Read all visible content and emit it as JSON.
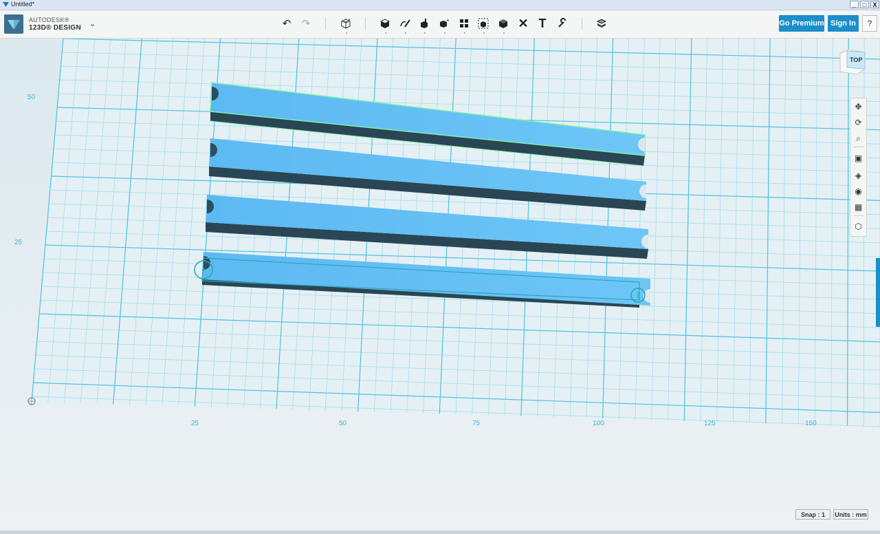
{
  "window": {
    "title": "Untitled*",
    "controls": [
      "_",
      "□",
      "X"
    ]
  },
  "app": {
    "brand_top": "AUTODESK®",
    "brand_bottom": "123D® DESIGN",
    "menu_chevron": "⌄"
  },
  "toolbar": {
    "undo_icon": "↶",
    "redo_icon": "↷",
    "tools": [
      "primitives-icon",
      "sketch-icon",
      "construct-icon",
      "modify-icon",
      "pattern-icon",
      "grouping-icon",
      "combine-icon",
      "measure-icon",
      "text-icon",
      "snap-icon",
      "material-icon"
    ],
    "text_tool_label": "T",
    "measure_label": "✕"
  },
  "account": {
    "premium_label": "Go Premium",
    "signin_label": "Sign In",
    "help_label": "?"
  },
  "viewcube": {
    "face_label": "TOP"
  },
  "axes": {
    "y_labels": [
      "50",
      "25"
    ],
    "x_labels": [
      "25",
      "50",
      "75",
      "100",
      "125",
      "150"
    ]
  },
  "nav_tools": [
    "pan-icon",
    "orbit-icon",
    "zoom-icon",
    "fit-icon",
    "view-icon",
    "visibility-icon",
    "material-view-icon",
    "snap-view-icon"
  ],
  "status": {
    "snap_label": "Snap : 1",
    "units_label": "Units : mm"
  },
  "colors": {
    "accent": "#1c8ec9",
    "grid": "#53c3e3",
    "part": "#62bdf3",
    "part_shadow": "#2a4654",
    "selection": "#7ef0a8",
    "canvas": "#e9f1f4"
  }
}
